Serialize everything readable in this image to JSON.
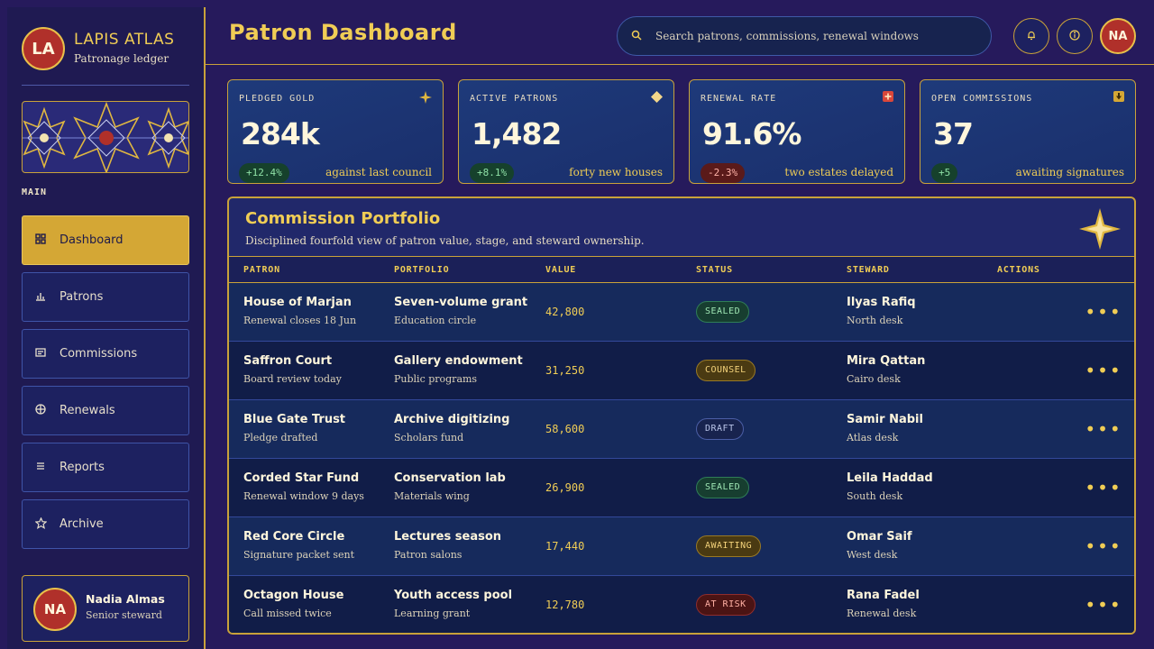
{
  "brand": {
    "initials": "LA",
    "name": "LAPIS ATLAS",
    "subtitle": "Patronage ledger"
  },
  "sidebar": {
    "section_label": "MAIN",
    "items": [
      {
        "label": "Dashboard",
        "icon": "grid-icon",
        "active": true
      },
      {
        "label": "Patrons",
        "icon": "bar-chart-icon",
        "active": false
      },
      {
        "label": "Commissions",
        "icon": "ledger-icon",
        "active": false
      },
      {
        "label": "Renewals",
        "icon": "globe-icon",
        "active": false
      },
      {
        "label": "Reports",
        "icon": "list-icon",
        "active": false
      },
      {
        "label": "Archive",
        "icon": "star-icon",
        "active": false
      }
    ],
    "profile": {
      "initials": "NA",
      "name": "Nadia Almas",
      "role": "Senior steward"
    }
  },
  "header": {
    "title": "Patron Dashboard",
    "search_placeholder": "Search patrons, commissions, renewal windows",
    "user_initials": "NA"
  },
  "stats": [
    {
      "label": "PLEDGED GOLD",
      "value": "284k",
      "delta": "+12.4%",
      "trend": "up",
      "note": "against last council",
      "icon": "sparkle-icon"
    },
    {
      "label": "ACTIVE PATRONS",
      "value": "1,482",
      "delta": "+8.1%",
      "trend": "up",
      "note": "forty new houses",
      "icon": "diamond-icon"
    },
    {
      "label": "RENEWAL RATE",
      "value": "91.6%",
      "delta": "-2.3%",
      "trend": "down",
      "note": "two estates delayed",
      "icon": "alert-cross-icon"
    },
    {
      "label": "OPEN COMMISSIONS",
      "value": "37",
      "delta": "+5",
      "trend": "up",
      "note": "awaiting signatures",
      "icon": "download-box-icon"
    }
  ],
  "portfolio": {
    "title": "Commission Portfolio",
    "subtitle": "Disciplined fourfold view of patron value, stage, and steward ownership.",
    "columns": [
      "PATRON",
      "PORTFOLIO",
      "VALUE",
      "STATUS",
      "STEWARD",
      "ACTIONS"
    ],
    "rows": [
      {
        "patron": "House of Marjan",
        "patron_note": "Renewal closes 18 Jun",
        "portfolio": "Seven-volume grant",
        "portfolio_note": "Education circle",
        "value": "42,800",
        "status": "SEALED",
        "status_kind": "sealed",
        "steward": "Ilyas Rafiq",
        "desk": "North desk"
      },
      {
        "patron": "Saffron Court",
        "patron_note": "Board review today",
        "portfolio": "Gallery endowment",
        "portfolio_note": "Public programs",
        "value": "31,250",
        "status": "COUNSEL",
        "status_kind": "counsel",
        "steward": "Mira Qattan",
        "desk": "Cairo desk"
      },
      {
        "patron": "Blue Gate Trust",
        "patron_note": "Pledge drafted",
        "portfolio": "Archive digitizing",
        "portfolio_note": "Scholars fund",
        "value": "58,600",
        "status": "DRAFT",
        "status_kind": "draft",
        "steward": "Samir Nabil",
        "desk": "Atlas desk"
      },
      {
        "patron": "Corded Star Fund",
        "patron_note": "Renewal window 9 days",
        "portfolio": "Conservation lab",
        "portfolio_note": "Materials wing",
        "value": "26,900",
        "status": "SEALED",
        "status_kind": "sealed",
        "steward": "Leila Haddad",
        "desk": "South desk"
      },
      {
        "patron": "Red Core Circle",
        "patron_note": "Signature packet sent",
        "portfolio": "Lectures season",
        "portfolio_note": "Patron salons",
        "value": "17,440",
        "status": "AWAITING",
        "status_kind": "awaiting",
        "steward": "Omar Saif",
        "desk": "West desk"
      },
      {
        "patron": "Octagon House",
        "patron_note": "Call missed twice",
        "portfolio": "Youth access pool",
        "portfolio_note": "Learning grant",
        "value": "12,780",
        "status": "AT RISK",
        "status_kind": "risk",
        "steward": "Rana Fadel",
        "desk": "Renewal desk"
      }
    ],
    "row_menu": "•••"
  },
  "colors": {
    "accent": "#f0cd55",
    "brand_red": "#b0302a",
    "background": "#261a5c",
    "panel": "#1e3a7a"
  }
}
